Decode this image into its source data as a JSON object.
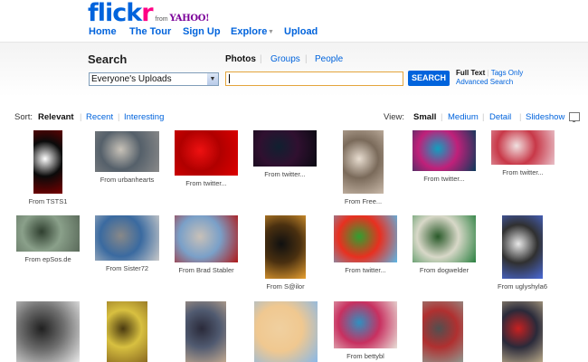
{
  "header": {
    "logo_flick": "flick",
    "logo_r": "r",
    "logo_from": "from",
    "logo_yahoo": "YAHOO!"
  },
  "nav": {
    "home": "Home",
    "tour": "The Tour",
    "signup": "Sign Up",
    "explore": "Explore",
    "explore_caret": "▼",
    "upload": "Upload"
  },
  "search": {
    "title": "Search",
    "tabs": [
      "Photos",
      "Groups",
      "People"
    ],
    "tab_separator": "|",
    "scope": "Everyone's Uploads",
    "dropdown_arrow": "▼",
    "query": "",
    "button": "SEARCH",
    "full_text": "Full Text",
    "option_separator": "|",
    "tags_only": "Tags Only",
    "advanced": "Advanced Search"
  },
  "sort": {
    "label": "Sort:",
    "relevant": "Relevant",
    "recent": "Recent",
    "interesting": "Interesting",
    "separator": "|"
  },
  "view": {
    "label": "View:",
    "small": "Small",
    "medium": "Medium",
    "detail": "Detail",
    "slideshow": "Slideshow",
    "separator": "|",
    "slideshow_icon": "monitor-icon"
  },
  "results": [
    {
      "caption": "From TSTS1",
      "colors": [
        "#7a0000",
        "#0a0a0a",
        "#ffffff"
      ]
    },
    {
      "caption": "From urbanhearts",
      "colors": [
        "#8a8a8a",
        "#55606a",
        "#c8c2b8"
      ]
    },
    {
      "caption": "From twitter...",
      "colors": [
        "#dd0000",
        "#b00000",
        "#ee1111"
      ]
    },
    {
      "caption": "From twitter...",
      "colors": [
        "#0a0a12",
        "#301030",
        "#102030"
      ]
    },
    {
      "caption": "From Free...",
      "colors": [
        "#c9b9a9",
        "#7a6a5a",
        "#e8ddd0"
      ]
    },
    {
      "caption": "From twitter...",
      "colors": [
        "#0a3a5a",
        "#c0207a",
        "#10a0c0"
      ]
    },
    {
      "caption": "From twitter...",
      "colors": [
        "#e8c0c8",
        "#c83848",
        "#f0e0e0"
      ]
    },
    {
      "caption": "From epSos.de",
      "colors": [
        "#5a6a5a",
        "#8aa08a",
        "#304030"
      ]
    },
    {
      "caption": "From Sister72",
      "colors": [
        "#c9c9c9",
        "#3a6aa0",
        "#888888"
      ]
    },
    {
      "caption": "From Brad Stabler",
      "colors": [
        "#b01818",
        "#7aa0c8",
        "#c8c0b8"
      ]
    },
    {
      "caption": "From S@ilor",
      "colors": [
        "#e8a030",
        "#4a3010",
        "#101010"
      ]
    },
    {
      "caption": "From twitter...",
      "colors": [
        "#5ab8e8",
        "#e83020",
        "#30a030"
      ]
    },
    {
      "caption": "From dogwelder",
      "colors": [
        "#2a8040",
        "#d8d8c8",
        "#2a5a2a"
      ]
    },
    {
      "caption": "From uglyshyla6",
      "colors": [
        "#4a6ad8",
        "#303030",
        "#e8e8e8"
      ]
    },
    {
      "caption": "",
      "colors": [
        "#e8e8e8",
        "#707070",
        "#202020"
      ]
    },
    {
      "caption": "",
      "colors": [
        "#8a6a20",
        "#d8c040",
        "#4a3a10"
      ]
    },
    {
      "caption": "",
      "colors": [
        "#c0a890",
        "#505a70",
        "#2a2a3a"
      ]
    },
    {
      "caption": "",
      "colors": [
        "#88b8e8",
        "#f0c890",
        "#f0d0a0"
      ]
    },
    {
      "caption": "From bettybl",
      "colors": [
        "#e8e0d8",
        "#c83060",
        "#3090c0"
      ]
    },
    {
      "caption": "",
      "colors": [
        "#909890",
        "#b03030",
        "#505050"
      ]
    },
    {
      "caption": "",
      "colors": [
        "#b8a888",
        "#2a2a3a",
        "#c82020"
      ]
    }
  ]
}
